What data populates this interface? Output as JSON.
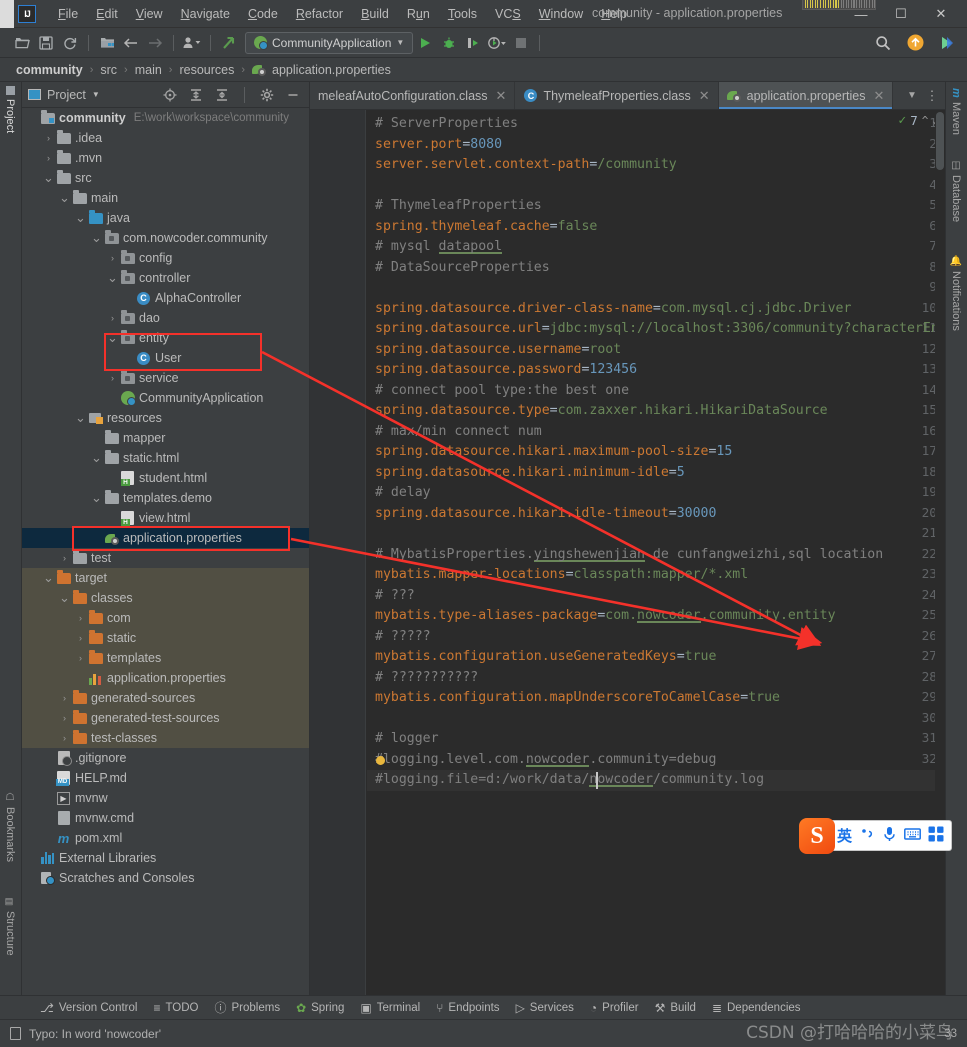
{
  "window": {
    "title": "community - application.properties",
    "logo_text": "IJ",
    "minimize": "—",
    "maximize": "☐",
    "close": "✕"
  },
  "menu": [
    {
      "label": "File",
      "mnemonic": "F"
    },
    {
      "label": "Edit",
      "mnemonic": "E"
    },
    {
      "label": "View",
      "mnemonic": "V"
    },
    {
      "label": "Navigate",
      "mnemonic": "N"
    },
    {
      "label": "Code",
      "mnemonic": "C"
    },
    {
      "label": "Refactor",
      "mnemonic": "R"
    },
    {
      "label": "Build",
      "mnemonic": "B"
    },
    {
      "label": "Run",
      "mnemonic": "u"
    },
    {
      "label": "Tools",
      "mnemonic": "T"
    },
    {
      "label": "VCS",
      "mnemonic": "S"
    },
    {
      "label": "Window",
      "mnemonic": "W"
    },
    {
      "label": "Help",
      "mnemonic": "H"
    }
  ],
  "toolbar": {
    "open_icon": "open-folder-icon",
    "save_icon": "save-icon",
    "sync_icon": "sync-icon",
    "project_structure_icon": "project-structure-icon",
    "back_icon": "back-arrow-icon",
    "forward_icon": "forward-arrow-icon",
    "profile_icon": "user-profile-icon",
    "update_icon": "update-project-icon",
    "run_config": "CommunityApplication",
    "run_icon": "run-icon",
    "debug_icon": "debug-icon",
    "run_coverage_icon": "run-with-coverage-icon",
    "profiler_icon": "profiler-icon",
    "stop_icon": "stop-icon",
    "search_icon": "search-everywhere-icon",
    "update_badge_icon": "update-available-icon",
    "share_icon": "code-with-me-icon"
  },
  "breadcrumb": [
    "community",
    "src",
    "main",
    "resources",
    "application.properties"
  ],
  "left_tool_strip": [
    "Project",
    "Bookmarks",
    "Structure"
  ],
  "right_tool_strip": [
    "Maven",
    "Database",
    "Notifications"
  ],
  "project_panel": {
    "title": "Project",
    "dropdown_icon": "chevron-down-icon",
    "locate_icon": "scroll-from-source-icon",
    "expand_icon": "expand-all-icon",
    "collapse_icon": "collapse-all-icon",
    "settings_icon": "gear-icon",
    "hide_icon": "minimize-icon",
    "tree": [
      {
        "label": "community",
        "path": "E:\\work\\workspace\\community",
        "depth": 0,
        "arrow": "",
        "icon": "module-folder-icon",
        "bold": true
      },
      {
        "label": ".idea",
        "depth": 1,
        "arrow": "›",
        "icon": "folder-icon"
      },
      {
        "label": ".mvn",
        "depth": 1,
        "arrow": "›",
        "icon": "folder-icon"
      },
      {
        "label": "src",
        "depth": 1,
        "arrow": "∨",
        "icon": "folder-icon"
      },
      {
        "label": "main",
        "depth": 2,
        "arrow": "∨",
        "icon": "folder-icon"
      },
      {
        "label": "java",
        "depth": 3,
        "arrow": "∨",
        "icon": "source-root-icon"
      },
      {
        "label": "com.nowcoder.community",
        "depth": 4,
        "arrow": "∨",
        "icon": "package-icon"
      },
      {
        "label": "config",
        "depth": 5,
        "arrow": "›",
        "icon": "package-icon"
      },
      {
        "label": "controller",
        "depth": 5,
        "arrow": "∨",
        "icon": "package-icon"
      },
      {
        "label": "AlphaController",
        "depth": 6,
        "arrow": "",
        "icon": "java-class-icon"
      },
      {
        "label": "dao",
        "depth": 5,
        "arrow": "›",
        "icon": "package-icon"
      },
      {
        "label": "entity",
        "depth": 5,
        "arrow": "∨",
        "icon": "package-icon",
        "highlight": true
      },
      {
        "label": "User",
        "depth": 6,
        "arrow": "",
        "icon": "java-class-icon",
        "highlight": true
      },
      {
        "label": "service",
        "depth": 5,
        "arrow": "›",
        "icon": "package-icon"
      },
      {
        "label": "CommunityApplication",
        "depth": 5,
        "arrow": "",
        "icon": "spring-boot-app-icon"
      },
      {
        "label": "resources",
        "depth": 3,
        "arrow": "∨",
        "icon": "resources-root-icon"
      },
      {
        "label": "mapper",
        "depth": 4,
        "arrow": "",
        "icon": "folder-icon"
      },
      {
        "label": "static.html",
        "depth": 4,
        "arrow": "∨",
        "icon": "folder-icon"
      },
      {
        "label": "student.html",
        "depth": 5,
        "arrow": "",
        "icon": "html-file-icon"
      },
      {
        "label": "templates.demo",
        "depth": 4,
        "arrow": "∨",
        "icon": "folder-icon"
      },
      {
        "label": "view.html",
        "depth": 5,
        "arrow": "",
        "icon": "html-file-icon"
      },
      {
        "label": "application.properties",
        "depth": 4,
        "arrow": "",
        "icon": "spring-properties-icon",
        "selected": true,
        "highlight": true
      },
      {
        "label": "test",
        "depth": 2,
        "arrow": "›",
        "icon": "folder-icon"
      },
      {
        "label": "target",
        "depth": 1,
        "arrow": "∨",
        "icon": "target-folder-icon",
        "excluded": true
      },
      {
        "label": "classes",
        "depth": 2,
        "arrow": "∨",
        "icon": "target-folder-icon",
        "excluded": true
      },
      {
        "label": "com",
        "depth": 3,
        "arrow": "›",
        "icon": "target-folder-icon",
        "excluded": true
      },
      {
        "label": "static",
        "depth": 3,
        "arrow": "›",
        "icon": "target-folder-icon",
        "excluded": true
      },
      {
        "label": "templates",
        "depth": 3,
        "arrow": "›",
        "icon": "target-folder-icon",
        "excluded": true
      },
      {
        "label": "application.properties",
        "depth": 3,
        "arrow": "",
        "icon": "properties-file-icon",
        "excluded": true
      },
      {
        "label": "generated-sources",
        "depth": 2,
        "arrow": "›",
        "icon": "target-folder-icon",
        "excluded": true
      },
      {
        "label": "generated-test-sources",
        "depth": 2,
        "arrow": "›",
        "icon": "target-folder-icon",
        "excluded": true
      },
      {
        "label": "test-classes",
        "depth": 2,
        "arrow": "›",
        "icon": "target-folder-icon",
        "excluded": true
      },
      {
        "label": ".gitignore",
        "depth": 1,
        "arrow": "",
        "icon": "gitignore-file-icon"
      },
      {
        "label": "HELP.md",
        "depth": 1,
        "arrow": "",
        "icon": "markdown-file-icon"
      },
      {
        "label": "mvnw",
        "depth": 1,
        "arrow": "",
        "icon": "script-file-icon"
      },
      {
        "label": "mvnw.cmd",
        "depth": 1,
        "arrow": "",
        "icon": "cmd-file-icon"
      },
      {
        "label": "pom.xml",
        "depth": 1,
        "arrow": "",
        "icon": "maven-pom-icon"
      },
      {
        "label": "External Libraries",
        "depth": 0,
        "arrow": "",
        "icon": "external-libraries-icon"
      },
      {
        "label": "Scratches and Consoles",
        "depth": 0,
        "arrow": "",
        "icon": "scratches-icon"
      }
    ]
  },
  "editor": {
    "tabs": [
      {
        "label": "meleafAutoConfiguration.class",
        "icon": "class-file-icon",
        "active": false
      },
      {
        "label": "ThymeleafProperties.class",
        "icon": "java-class-icon",
        "active": false
      },
      {
        "label": "application.properties",
        "icon": "spring-properties-icon",
        "active": true
      }
    ],
    "tab_list_icon": "chevron-down-icon",
    "tab_options_icon": "more-options-icon",
    "inspection_count": "7",
    "inspection_icon": "inspection-ok-icon",
    "prev_problem_icon": "prev-problem-icon",
    "next_problem_icon": "next-problem-icon",
    "file_name": "application.properties",
    "lines": [
      {
        "n": 1,
        "text": "# ServerProperties",
        "type": "comment"
      },
      {
        "n": 2,
        "text": "server.port=8080",
        "type": "kv",
        "key": "server.port",
        "value": "8080",
        "value_type": "number"
      },
      {
        "n": 3,
        "text": "server.servlet.context-path=/community",
        "type": "kv",
        "key": "server.servlet.context-path",
        "value": "/community",
        "value_type": "string"
      },
      {
        "n": 4,
        "text": "",
        "type": "blank"
      },
      {
        "n": 5,
        "text": "# ThymeleafProperties",
        "type": "comment"
      },
      {
        "n": 6,
        "text": "spring.thymeleaf.cache=false",
        "type": "kv",
        "key": "spring.thymeleaf.cache",
        "value": "false",
        "value_type": "string"
      },
      {
        "n": 7,
        "text": "# mysql datapool",
        "type": "comment",
        "typo": "datapool"
      },
      {
        "n": 8,
        "text": "# DataSourceProperties",
        "type": "comment"
      },
      {
        "n": 9,
        "text": "",
        "type": "blank"
      },
      {
        "n": 10,
        "text": "spring.datasource.driver-class-name=com.mysql.cj.jdbc.Driver",
        "type": "kv",
        "key": "spring.datasource.driver-class-name",
        "value": "com.mysql.cj.jdbc.Driver",
        "value_type": "string"
      },
      {
        "n": 11,
        "text": "spring.datasource.url=jdbc:mysql://localhost:3306/community?characterEn",
        "type": "kv",
        "key": "spring.datasource.url",
        "value": "jdbc:mysql://localhost:3306/community?characterEn",
        "value_type": "string",
        "truncated": true
      },
      {
        "n": 12,
        "text": "spring.datasource.username=root",
        "type": "kv",
        "key": "spring.datasource.username",
        "value": "root",
        "value_type": "string"
      },
      {
        "n": 13,
        "text": "spring.datasource.password=123456",
        "type": "kv",
        "key": "spring.datasource.password",
        "value": "123456",
        "value_type": "number"
      },
      {
        "n": 14,
        "text": "# connect pool type:the best one",
        "type": "comment"
      },
      {
        "n": 15,
        "text": "spring.datasource.type=com.zaxxer.hikari.HikariDataSource",
        "type": "kv",
        "key": "spring.datasource.type",
        "value": "com.zaxxer.hikari.HikariDataSource",
        "value_type": "string"
      },
      {
        "n": 16,
        "text": "# max/min connect num",
        "type": "comment"
      },
      {
        "n": 17,
        "text": "spring.datasource.hikari.maximum-pool-size=15",
        "type": "kv",
        "key": "spring.datasource.hikari.maximum-pool-size",
        "value": "15",
        "value_type": "number"
      },
      {
        "n": 18,
        "text": "spring.datasource.hikari.minimum-idle=5",
        "type": "kv",
        "key": "spring.datasource.hikari.minimum-idle",
        "value": "5",
        "value_type": "number"
      },
      {
        "n": 19,
        "text": "# delay",
        "type": "comment"
      },
      {
        "n": 20,
        "text": "spring.datasource.hikari.idle-timeout=30000",
        "type": "kv",
        "key": "spring.datasource.hikari.idle-timeout",
        "value": "30000",
        "value_type": "number"
      },
      {
        "n": 21,
        "text": "",
        "type": "blank"
      },
      {
        "n": 22,
        "text": "# MybatisProperties.yingshewenjian de cunfangweizhi,sql location",
        "type": "comment",
        "typo": "yingshewenjian"
      },
      {
        "n": 23,
        "text": "mybatis.mapper-locations=classpath:mapper/*.xml",
        "type": "kv",
        "key": "mybatis.mapper-locations",
        "value": "classpath:mapper/*.xml",
        "value_type": "string"
      },
      {
        "n": 24,
        "text": "# ???",
        "type": "comment"
      },
      {
        "n": 25,
        "text": "mybatis.type-aliases-package=com.nowcoder.community.entity",
        "type": "kv",
        "key": "mybatis.type-aliases-package",
        "value": "com.nowcoder.community.entity",
        "value_type": "string",
        "typo": "nowcoder"
      },
      {
        "n": 26,
        "text": "# ?????",
        "type": "comment"
      },
      {
        "n": 27,
        "text": "mybatis.configuration.useGeneratedKeys=true",
        "type": "kv",
        "key": "mybatis.configuration.useGeneratedKeys",
        "value": "true",
        "value_type": "string"
      },
      {
        "n": 28,
        "text": "# ???????????",
        "type": "comment"
      },
      {
        "n": 29,
        "text": "mybatis.configuration.mapUnderscoreToCamelCase=true",
        "type": "kv",
        "key": "mybatis.configuration.mapUnderscoreToCamelCase",
        "value": "true",
        "value_type": "string"
      },
      {
        "n": 30,
        "text": "",
        "type": "blank"
      },
      {
        "n": 31,
        "text": "# logger",
        "type": "comment"
      },
      {
        "n": 32,
        "text": "#logging.level.com.nowcoder.community=debug",
        "type": "comment",
        "typo": "nowcoder",
        "bulb": true
      },
      {
        "n": 33,
        "text": "#logging.file=d:/work/data/nowcoder/community.log",
        "type": "comment",
        "typo": "nowcoder",
        "current": true
      }
    ]
  },
  "ime": {
    "logo": "S",
    "mode": "英",
    "punctuation_icon": "punctuation-toggle-icon",
    "voice_icon": "microphone-icon",
    "keyboard_icon": "soft-keyboard-icon",
    "apps_icon": "apps-grid-icon"
  },
  "bottom_tools": [
    {
      "label": "Version Control",
      "icon": "version-control-icon"
    },
    {
      "label": "TODO",
      "icon": "todo-icon"
    },
    {
      "label": "Problems",
      "icon": "problems-icon"
    },
    {
      "label": "Spring",
      "icon": "spring-leaf-icon"
    },
    {
      "label": "Terminal",
      "icon": "terminal-icon"
    },
    {
      "label": "Endpoints",
      "icon": "endpoints-icon"
    },
    {
      "label": "Services",
      "icon": "services-icon"
    },
    {
      "label": "Profiler",
      "icon": "profiler-icon"
    },
    {
      "label": "Build",
      "icon": "build-hammer-icon"
    },
    {
      "label": "Dependencies",
      "icon": "dependencies-icon"
    }
  ],
  "status_bar": {
    "message": "Typo: In word 'nowcoder'",
    "message_icon": "inspection-info-icon",
    "caret_position": "33"
  },
  "watermark": "CSDN @打哈哈哈的小菜鸟"
}
